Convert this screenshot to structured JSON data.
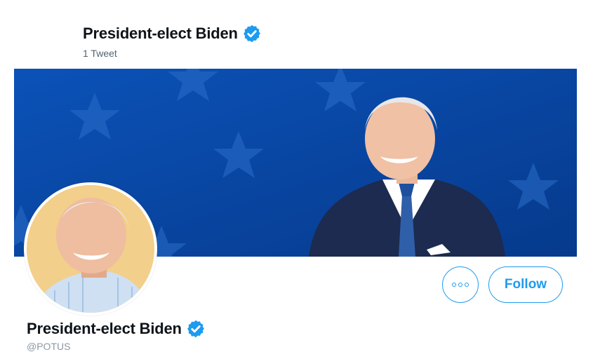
{
  "header": {
    "title": "President-elect Biden",
    "tweet_count": "1 Tweet",
    "verified_icon": "verified-badge-icon"
  },
  "banner": {
    "description_icon": "banner-photo"
  },
  "profile": {
    "display_name": "President-elect Biden",
    "handle": "@POTUS",
    "avatar_icon": "avatar-photo"
  },
  "actions": {
    "more_icon": "more-options-icon",
    "follow_label": "Follow"
  },
  "colors": {
    "accent": "#1d9bf0",
    "banner_blue": "#0a4aa8",
    "avatar_bg": "#f2cf8a"
  }
}
